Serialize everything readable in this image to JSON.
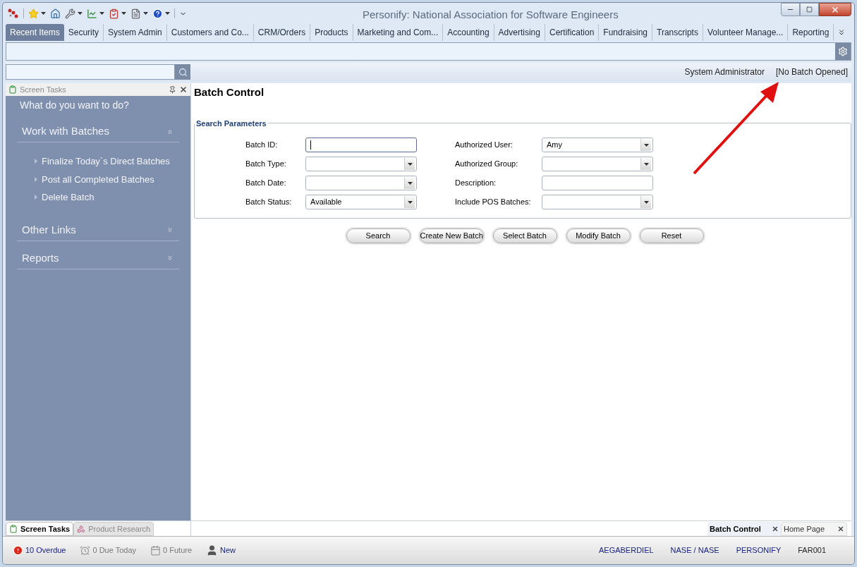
{
  "window": {
    "title": "Personify: National Association for Software Engineers"
  },
  "tabs": [
    {
      "label": "Recent Items",
      "selected": true
    },
    {
      "label": "Security",
      "selected": false
    },
    {
      "label": "System Admin",
      "selected": false
    },
    {
      "label": "Customers and Co...",
      "selected": false
    },
    {
      "label": "CRM/Orders",
      "selected": false
    },
    {
      "label": "Products",
      "selected": false
    },
    {
      "label": "Marketing and Com...",
      "selected": false
    },
    {
      "label": "Accounting",
      "selected": false
    },
    {
      "label": "Advertising",
      "selected": false
    },
    {
      "label": "Certification",
      "selected": false
    },
    {
      "label": "Fundraising",
      "selected": false
    },
    {
      "label": "Transcripts",
      "selected": false
    },
    {
      "label": "Volunteer Manage...",
      "selected": false
    },
    {
      "label": "Reporting",
      "selected": false
    }
  ],
  "header": {
    "user": "System Administrator",
    "batch": "[No Batch Opened]"
  },
  "sidebar": {
    "title": "Screen Tasks",
    "heading": "What do you want to do?",
    "sections": [
      {
        "title": "Work with Batches",
        "expanded": true,
        "items": [
          "Finalize Today`s Direct Batches",
          "Post all Completed Batches",
          "Delete Batch"
        ]
      },
      {
        "title": "Other Links",
        "expanded": false
      },
      {
        "title": "Reports",
        "expanded": false
      }
    ]
  },
  "panel_tabs": [
    {
      "label": "Screen Tasks",
      "selected": true
    },
    {
      "label": "Product Research",
      "selected": false
    }
  ],
  "page": {
    "title": "Batch Control",
    "legend": "Search Parameters",
    "fields": [
      {
        "label": "Batch ID:",
        "kind": "text",
        "focused": true
      },
      {
        "label": "Authorized User:",
        "kind": "select",
        "value": "Amy",
        "focused": false
      },
      {
        "label": "Batch Type:",
        "kind": "select",
        "focused": false
      },
      {
        "label": "Authorized Group:",
        "kind": "select",
        "focused": false
      },
      {
        "label": "Batch Date:",
        "kind": "select",
        "focused": false
      },
      {
        "label": "Description:",
        "kind": "text",
        "focused": false
      },
      {
        "label": "Batch Status:",
        "kind": "select",
        "value": "Available",
        "focused": false
      },
      {
        "label": "Include POS Batches:",
        "kind": "select",
        "focused": false
      }
    ],
    "buttons": [
      "Search",
      "Create New Batch",
      "Select Batch",
      "Modify Batch",
      "Reset"
    ]
  },
  "doc_tabs": [
    {
      "label": "Batch Control",
      "selected": true
    },
    {
      "label": "Home Page",
      "selected": false
    }
  ],
  "status_bar": {
    "left": [
      {
        "kind": "overdue",
        "text": "10 Overdue"
      },
      {
        "kind": "due_today",
        "text": "0 Due Today"
      },
      {
        "kind": "future",
        "text": "0 Future"
      },
      {
        "kind": "new",
        "text": "New"
      }
    ],
    "right": [
      "AEGABERDIEL",
      "NASE / NASE",
      "PERSONIFY",
      "FAR001"
    ]
  }
}
